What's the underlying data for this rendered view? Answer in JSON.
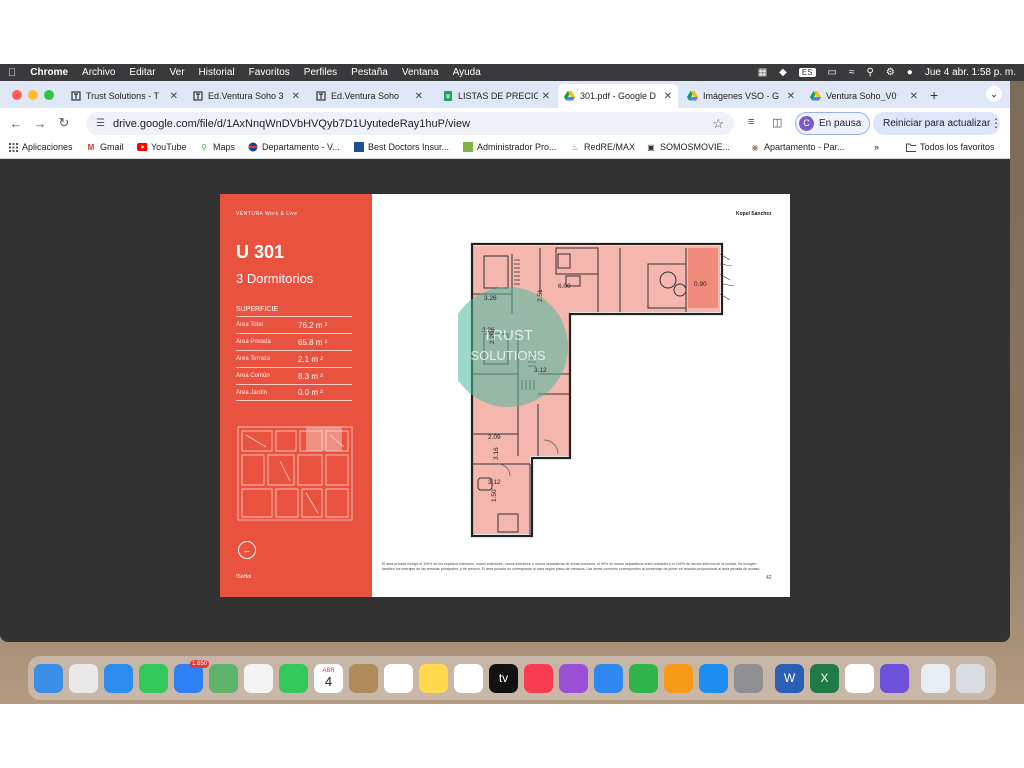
{
  "menubar": {
    "app": "Chrome",
    "items": [
      "Archivo",
      "Editar",
      "Ver",
      "Historial",
      "Favoritos",
      "Perfiles",
      "Pestaña",
      "Ventana",
      "Ayuda"
    ],
    "input_source": "ES",
    "datetime": "Jue 4 abr.  1:58 p. m."
  },
  "tabs": [
    {
      "title": "Trust Solutions - T",
      "icon": "trust-icon"
    },
    {
      "title": "Ed.Ventura Soho 3",
      "icon": "trust-icon"
    },
    {
      "title": "Ed.Ventura Soho",
      "icon": "trust-icon"
    },
    {
      "title": "LISTAS DE PRECIO",
      "icon": "sheets-icon"
    },
    {
      "title": "301.pdf - Google D",
      "icon": "drive-icon",
      "active": true
    },
    {
      "title": "Imágenes VSO - G",
      "icon": "drive-icon"
    },
    {
      "title": "Ventura Soho_V0",
      "icon": "drive-icon"
    }
  ],
  "toolbar": {
    "url": "drive.google.com/file/d/1AxNnqWnDVbHVQyb7D1UyutedeRay1huP/view",
    "profile_initial": "C",
    "paused_label": "En pausa",
    "restart_label": "Reiniciar para actualizar"
  },
  "bookmarks": [
    {
      "label": "Aplicaciones",
      "icon": "apps-icon"
    },
    {
      "label": "Gmail",
      "icon": "gmail-icon"
    },
    {
      "label": "YouTube",
      "icon": "youtube-icon"
    },
    {
      "label": "Maps",
      "icon": "maps-icon"
    },
    {
      "label": "Departamento - V...",
      "icon": "remax-icon"
    },
    {
      "label": "Best Doctors Insur...",
      "icon": "bestdoctors-icon"
    },
    {
      "label": "Administrador Pro...",
      "icon": "admin-icon"
    },
    {
      "label": "RedRE/MAX",
      "icon": "redremax-icon"
    },
    {
      "label": "SOMOSMOVIE...",
      "icon": "movie-icon"
    },
    {
      "label": "Apartamento - Par...",
      "icon": "apartment-icon"
    }
  ],
  "bookmarks_overflow": "»",
  "all_bookmarks": "Todos los favoritos",
  "pdf": {
    "brand": "VENTURA Work & Live",
    "unit": "U 301",
    "rooms": "3 Dormitorios",
    "superficie_title": "SUPERFICIE",
    "areas": [
      {
        "label": "Área Total",
        "value": "76.2 m ²"
      },
      {
        "label": "Área Privada",
        "value": "65.8 m ²"
      },
      {
        "label": "Área Terraza",
        "value": "2.1 m ²"
      },
      {
        "label": "Área Común",
        "value": "8.3 m ²"
      },
      {
        "label": "Área Jardín",
        "value": "0.0 m ²"
      }
    ],
    "soho": "\\SoHo\\",
    "architect": "Kopel Sánchez",
    "watermark_line1": "TRUST",
    "watermark_line2": "SOLUTIONS",
    "dimensions": [
      "3.26",
      "2.51",
      "6.00",
      "0.90",
      "3.26",
      "2.20",
      "3.12",
      "2.09",
      "3.16",
      "3.12",
      "1.50"
    ],
    "footnote": "El área privada incluye el 100% de los espacios interiores, muros exteriores, muros interiores, y muros separativos de áreas comunes, el 50% de muros separativos entre unidades y el 100% de ductos internos de la unidad. Se incluyen también los metrajes de las terrazas principales, y de servicio. El área privada no corresponde al área según plano de mensura. Las áreas comunes corresponden al porcentaje de juliver en relación proporcional al área privada de acceso.",
    "page_number": "42"
  },
  "dock": [
    {
      "name": "finder-icon",
      "color": "#3a8ee6"
    },
    {
      "name": "launchpad-icon",
      "color": "#e9e9e9"
    },
    {
      "name": "safari-icon",
      "color": "#2d8cf0"
    },
    {
      "name": "messages-icon",
      "color": "#34c759"
    },
    {
      "name": "mail-icon",
      "color": "#2f7ff5",
      "badge": "1.650"
    },
    {
      "name": "maps-icon",
      "color": "#5fb36a"
    },
    {
      "name": "photos-icon",
      "color": "#f4f4f4"
    },
    {
      "name": "facetime-icon",
      "color": "#34c759"
    },
    {
      "name": "calendar-icon",
      "color": "#ffffff",
      "text": "4",
      "month": "ABR"
    },
    {
      "name": "contacts-icon",
      "color": "#b08a5a"
    },
    {
      "name": "reminders-icon",
      "color": "#ffffff"
    },
    {
      "name": "notes-icon",
      "color": "#ffd84d"
    },
    {
      "name": "freeform-icon",
      "color": "#ffffff"
    },
    {
      "name": "appletv-icon",
      "color": "#111111",
      "text": "tv"
    },
    {
      "name": "music-icon",
      "color": "#fa3c52"
    },
    {
      "name": "podcasts-icon",
      "color": "#9b4fd6"
    },
    {
      "name": "keynote-icon",
      "color": "#2f88f0"
    },
    {
      "name": "numbers-icon",
      "color": "#2fb44c"
    },
    {
      "name": "pages-icon",
      "color": "#f79a1a"
    },
    {
      "name": "appstore-icon",
      "color": "#1d8df2"
    },
    {
      "name": "settings-icon",
      "color": "#8e8e93"
    },
    {
      "name": "word-icon",
      "color": "#2b5fb4",
      "text": "W"
    },
    {
      "name": "excel-icon",
      "color": "#1f7a43",
      "text": "X"
    },
    {
      "name": "chrome-icon",
      "color": "#ffffff"
    },
    {
      "name": "shortcut-icon",
      "color": "#6c52d9"
    },
    {
      "name": "archive-icon",
      "color": "#e8edf2"
    },
    {
      "name": "trash-icon",
      "color": "#d9dde2"
    }
  ]
}
